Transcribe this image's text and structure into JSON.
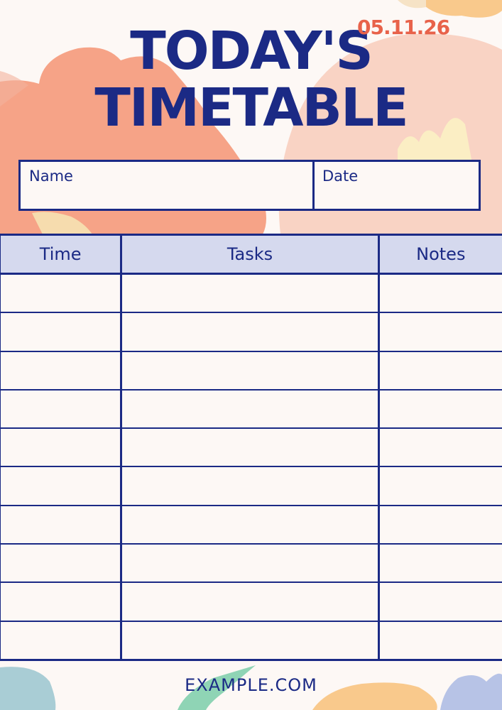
{
  "title": {
    "line1": "TODAY'S",
    "line2": "TIMETABLE"
  },
  "info": {
    "name_label": "Name",
    "name_value": "",
    "date_label": "Date",
    "date_value": "05.11.26"
  },
  "table": {
    "headers": [
      "Time",
      "Tasks",
      "Notes"
    ],
    "rows": [
      [
        "",
        "",
        ""
      ],
      [
        "",
        "",
        ""
      ],
      [
        "",
        "",
        ""
      ],
      [
        "",
        "",
        ""
      ],
      [
        "",
        "",
        ""
      ],
      [
        "",
        "",
        ""
      ],
      [
        "",
        "",
        ""
      ],
      [
        "",
        "",
        ""
      ],
      [
        "",
        "",
        ""
      ],
      [
        "",
        "",
        ""
      ]
    ]
  },
  "footer": {
    "website": "EXAMPLE.COM"
  },
  "colors": {
    "primary": "#1b2a85",
    "accent": "#e8624a",
    "header_fill": "#d5d9ee",
    "paper": "#fdf8f5"
  }
}
